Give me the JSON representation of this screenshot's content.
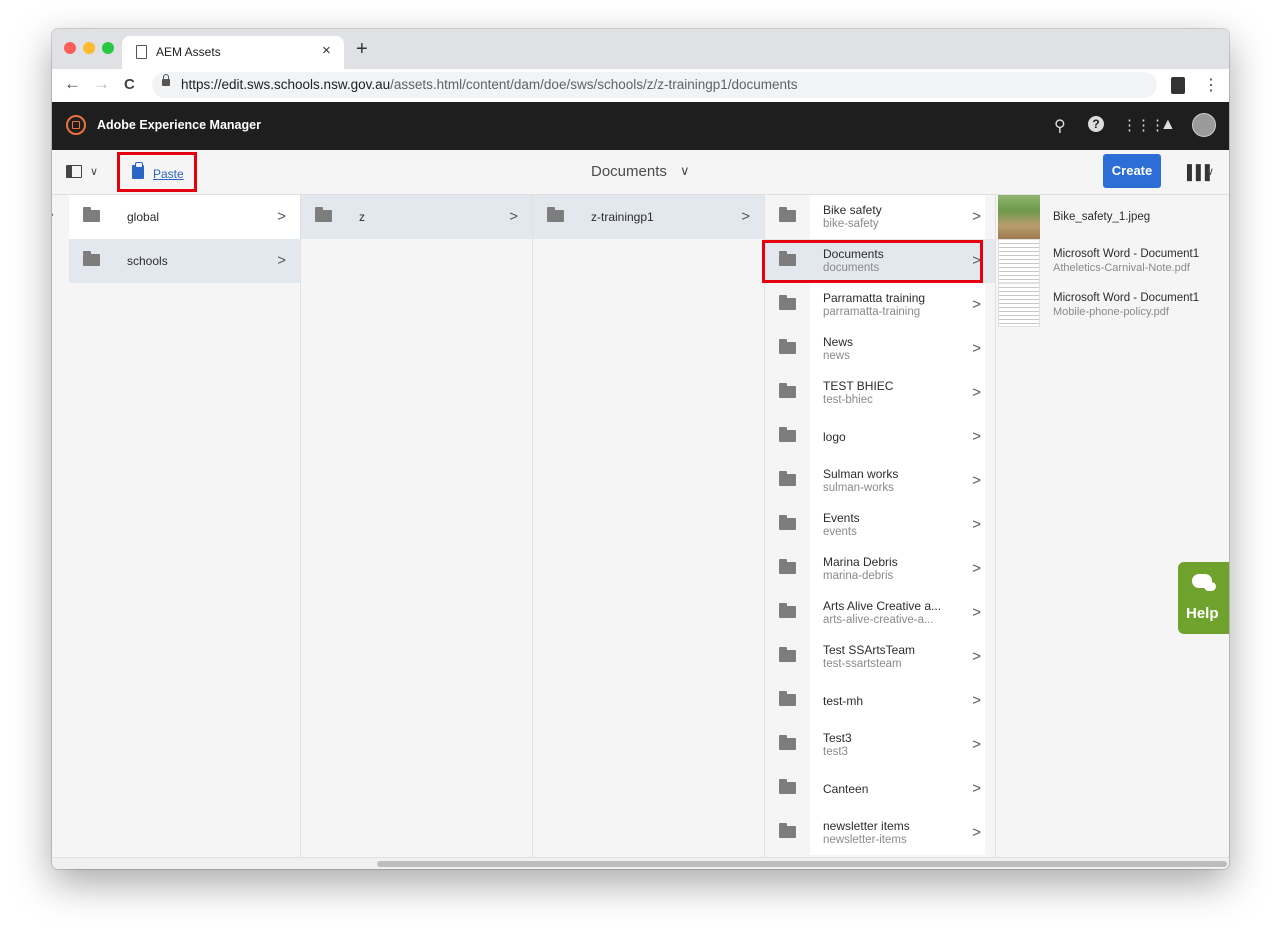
{
  "browser": {
    "tab_title": "AEM Assets",
    "close_glyph": "×",
    "new_tab_glyph": "+",
    "url_host": "https://edit.sws.schools.nsw.gov.au",
    "url_path": "/assets.html/content/dam/doe/sws/schools/z/z-trainingp1/documents",
    "back_glyph": "←",
    "forward_glyph": "→",
    "reload_glyph": "C",
    "menu_glyph": "⋮"
  },
  "aem_header": {
    "title": "Adobe Experience Manager",
    "icons": [
      "search-icon",
      "help-icon",
      "apps-icon",
      "bell-icon",
      "avatar"
    ]
  },
  "action_bar": {
    "paste_label": "Paste",
    "breadcrumb_title": "Documents",
    "create_label": "Create"
  },
  "columns": {
    "col1": [
      {
        "title": "global",
        "subtitle": ""
      },
      {
        "title": "schools",
        "subtitle": ""
      }
    ],
    "col2": [
      {
        "title": "z",
        "subtitle": ""
      }
    ],
    "col3": [
      {
        "title": "z-trainingp1",
        "subtitle": ""
      }
    ],
    "col4": [
      {
        "title": "Bike safety",
        "subtitle": "bike-safety"
      },
      {
        "title": "Documents",
        "subtitle": "documents"
      },
      {
        "title": "Parramatta training",
        "subtitle": "parramatta-training"
      },
      {
        "title": "News",
        "subtitle": "news"
      },
      {
        "title": "TEST BHIEC",
        "subtitle": "test-bhiec"
      },
      {
        "title": "logo",
        "subtitle": ""
      },
      {
        "title": "Sulman works",
        "subtitle": "sulman-works"
      },
      {
        "title": "Events",
        "subtitle": "events"
      },
      {
        "title": "Marina Debris",
        "subtitle": "marina-debris"
      },
      {
        "title": "Arts Alive Creative a...",
        "subtitle": "arts-alive-creative-a..."
      },
      {
        "title": "Test SSArtsTeam",
        "subtitle": "test-ssartsteam"
      },
      {
        "title": "test-mh",
        "subtitle": ""
      },
      {
        "title": "Test3",
        "subtitle": "test3"
      },
      {
        "title": "Canteen",
        "subtitle": ""
      },
      {
        "title": "newsletter items",
        "subtitle": "newsletter-items"
      }
    ],
    "preview": [
      {
        "title": "Bike_safety_1.jpeg",
        "subtitle": ""
      },
      {
        "title": "Microsoft Word - Document1",
        "subtitle": "Atheletics-Carnival-Note.pdf"
      },
      {
        "title": "Microsoft Word - Document1",
        "subtitle": "Mobile-phone-policy.pdf"
      }
    ]
  },
  "help": {
    "label": "Help"
  },
  "colors": {
    "accent": "#2d6ed6",
    "header_bg": "#1e1e1e",
    "highlight": "#e4000f",
    "help_bg": "#6fa32e"
  }
}
